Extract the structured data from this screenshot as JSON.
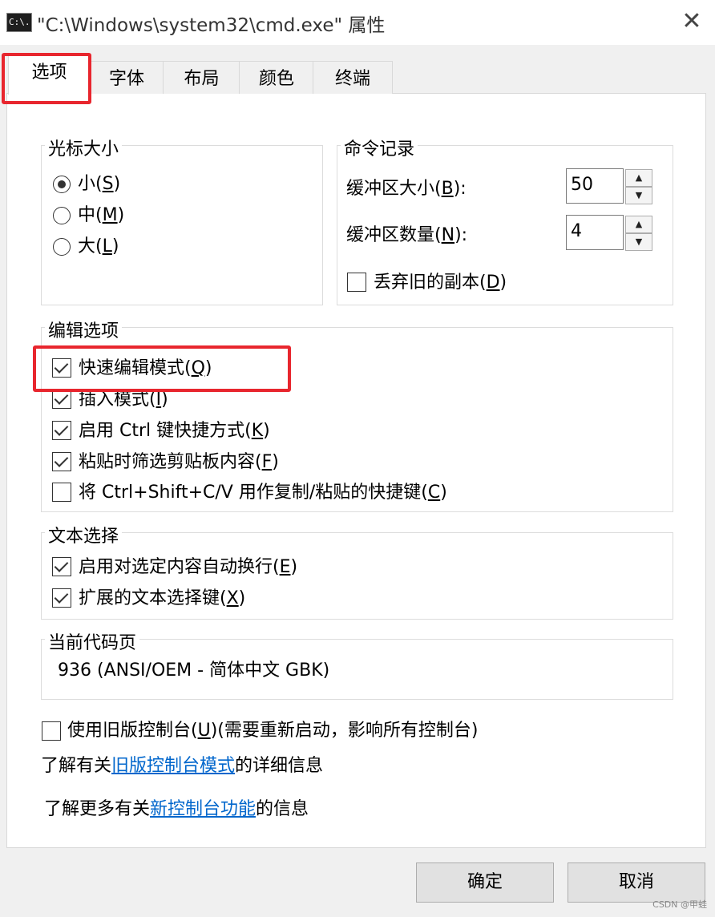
{
  "window": {
    "icon_text": "C:\\.",
    "title": "\"C:\\Windows\\system32\\cmd.exe\" 属性",
    "close": "✕"
  },
  "tabs": [
    {
      "label": "选项",
      "active": true
    },
    {
      "label": "字体"
    },
    {
      "label": "布局"
    },
    {
      "label": "颜色"
    },
    {
      "label": "终端"
    }
  ],
  "cursor_size": {
    "title": "光标大小",
    "options": [
      {
        "text": "小(",
        "key": "S",
        "end": ")",
        "selected": true
      },
      {
        "text": "中(",
        "key": "M",
        "end": ")",
        "selected": false
      },
      {
        "text": "大(",
        "key": "L",
        "end": ")",
        "selected": false
      }
    ]
  },
  "command_history": {
    "title": "命令记录",
    "buffer_size": {
      "text": "缓冲区大小(",
      "key": "B",
      "end": "):",
      "value": "50"
    },
    "buffer_count": {
      "text": "缓冲区数量(",
      "key": "N",
      "end": "):",
      "value": "4"
    },
    "discard": {
      "text": "丢弃旧的副本(",
      "key": "D",
      "end": ")",
      "checked": false
    }
  },
  "edit_options": {
    "title": "编辑选项",
    "items": [
      {
        "text": "快速编辑模式(",
        "key": "Q",
        "end": ")",
        "checked": true
      },
      {
        "text": "插入模式(",
        "key": "I",
        "end": ")",
        "checked": true
      },
      {
        "text": "启用 Ctrl 键快捷方式(",
        "key": "K",
        "end": ")",
        "checked": true
      },
      {
        "text": "粘贴时筛选剪贴板内容(",
        "key": "F",
        "end": ")",
        "checked": true
      },
      {
        "text": "将 Ctrl+Shift+C/V 用作复制/粘贴的快捷键(",
        "key": "C",
        "end": ")",
        "checked": false
      }
    ]
  },
  "text_selection": {
    "title": "文本选择",
    "items": [
      {
        "text": "启用对选定内容自动换行(",
        "key": "E",
        "end": ")",
        "checked": true
      },
      {
        "text": "扩展的文本选择键(",
        "key": "X",
        "end": ")",
        "checked": true
      }
    ]
  },
  "codepage": {
    "title": "当前代码页",
    "value": "936   (ANSI/OEM - 简体中文 GBK)"
  },
  "legacy": {
    "text": "使用旧版控制台(",
    "key": "U",
    "end": ")(需要重新启动，影响所有控制台)",
    "checked": false
  },
  "info1": {
    "pre": "了解有关",
    "link": "旧版控制台模式",
    "post": "的详细信息"
  },
  "info2": {
    "pre": "了解更多有关",
    "link": "新控制台功能",
    "post": "的信息"
  },
  "buttons": {
    "ok": "确定",
    "cancel": "取消"
  },
  "watermark": "CSDN @甲蛙",
  "colors": {
    "highlight": "#e8262e",
    "link": "#0066cc"
  }
}
